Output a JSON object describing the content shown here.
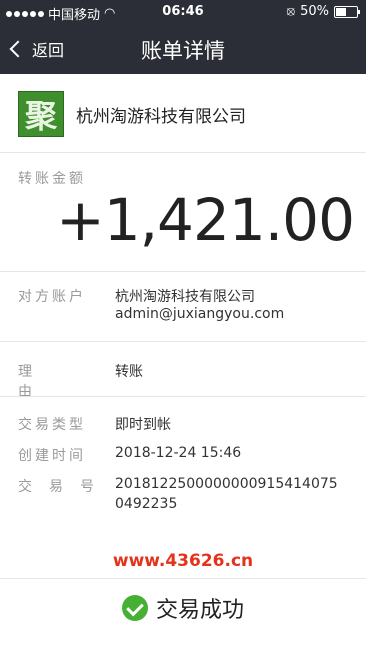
{
  "status_bar": {
    "carrier": "中国移动",
    "time": "06:46",
    "battery": "50%",
    "battery_level": 0.5
  },
  "nav": {
    "back_label": "返回",
    "title": "账单详情"
  },
  "merchant": {
    "logo_text": "聚",
    "name": "杭州淘游科技有限公司"
  },
  "amount": {
    "label": "转账金额",
    "value": "+1,421.00"
  },
  "counterparty": {
    "label": "对方账户",
    "name": "杭州淘游科技有限公司",
    "account": "admin@juxiangyou.com"
  },
  "reason": {
    "label": "理由",
    "value": "转账"
  },
  "details": {
    "type_label": "交易类型",
    "type_value": "即时到帐",
    "created_label": "创建时间",
    "created_value": "2018-12-24 15:46",
    "txn_label": "交易号",
    "txn_line1": "201812250000000091541407​5",
    "txn_line2": "0492235"
  },
  "watermark": "www.43626.cn",
  "status": {
    "text": "交易成功",
    "color": "#46b035"
  }
}
